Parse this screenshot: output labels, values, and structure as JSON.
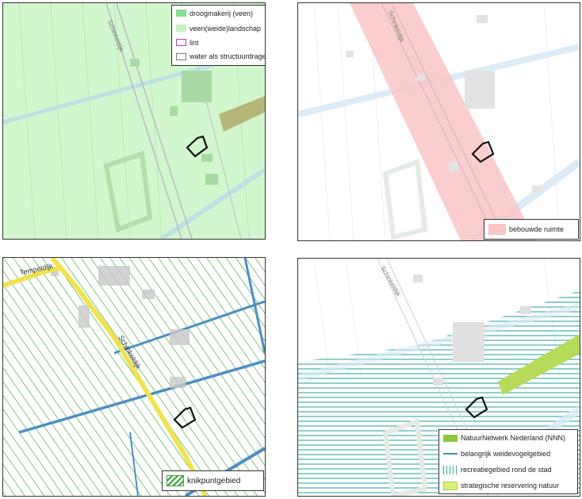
{
  "panels": [
    {
      "id": "top-left",
      "road_label": "Schinkeldijk",
      "legend": [
        {
          "label": "droogmakerij (veen)",
          "color": "#86e08f",
          "style": "fill"
        },
        {
          "label": "veen(weide)landschap",
          "color": "#c6f2c3",
          "style": "fill"
        },
        {
          "label": "lint",
          "color": "#b03fb5",
          "style": "outline"
        },
        {
          "label": "water als structuurdrager",
          "color": "#7a7a7a",
          "style": "outline"
        }
      ]
    },
    {
      "id": "top-right",
      "road_label": "Schinkeldijk",
      "legend": [
        {
          "label": "bebouwde ruimte",
          "color": "#f9c5c5",
          "style": "fill"
        }
      ]
    },
    {
      "id": "bottom-left",
      "road_labels": [
        "Tempeldijk",
        "Schinkeldijk"
      ],
      "legend": [
        {
          "label": "knikpuntgebied",
          "color": "#3aa63a",
          "style": "hatch"
        }
      ]
    },
    {
      "id": "bottom-right",
      "road_label": "Schinkeldijk",
      "legend": [
        {
          "label": "NatuurNetwerk Nederland (NNN)",
          "color": "#8cc63f",
          "style": "fill"
        },
        {
          "label": "belangrijk weidevogelgebied",
          "color": "#2aa1a8",
          "style": "line"
        },
        {
          "label": "recreatiegebied rond de stad",
          "color": "#2fb3a0",
          "style": "vlines"
        },
        {
          "label": "strategische reservering natuur",
          "color": "#d7f07a",
          "style": "dotted"
        }
      ]
    }
  ]
}
